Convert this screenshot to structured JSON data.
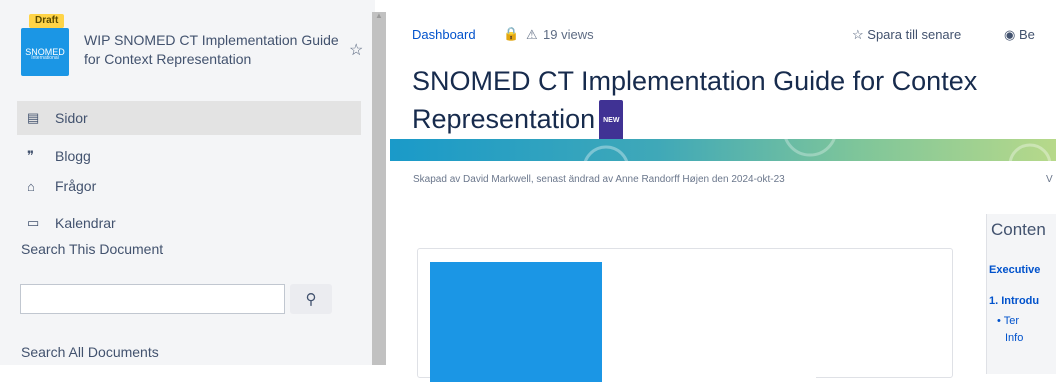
{
  "space": {
    "badge": "Draft",
    "logo_text": "SNOMED",
    "logo_sub": "International",
    "title": "WIP SNOMED CT Implementation Guide for Context Representation"
  },
  "sidebar": {
    "items": [
      {
        "label": "Sidor",
        "icon": "pages-icon",
        "glyph": "▤"
      },
      {
        "label": "Blogg",
        "icon": "quote-icon",
        "glyph": "❞"
      },
      {
        "label": "Frågor",
        "icon": "questions-icon",
        "glyph": "⌂"
      },
      {
        "label": "Kalendrar",
        "icon": "calendar-icon",
        "glyph": "▭"
      }
    ],
    "search_this_label": "Search This Document",
    "search_value": "",
    "search_all_label": "Search All Documents"
  },
  "page": {
    "breadcrumb": "Dashboard",
    "views": "19 views",
    "save_later": "Spara till senare",
    "watch": "Be",
    "title_line1": "SNOMED CT Implementation Guide for Contex",
    "title_line2": "Representation",
    "new_badge": "NEW",
    "byline": "Skapad av David Markwell, senast ändrad av Anne Randorff Højen den 2024-okt-23",
    "byline_cut": "V"
  },
  "toc": {
    "title": "Conten",
    "l1": "Executive",
    "l2": "1. Introdu",
    "l3a": "• Ter",
    "l3b": "Info"
  },
  "colors": {
    "link": "#0052cc",
    "logo_blue": "#1b96e5",
    "draft_yellow": "#ffd447",
    "lock_red": "#de350b"
  }
}
